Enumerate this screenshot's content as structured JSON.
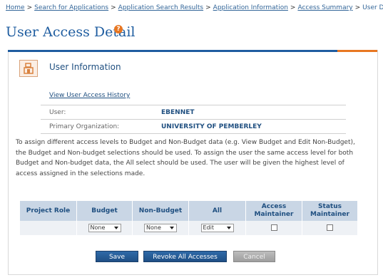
{
  "breadcrumb": {
    "items": [
      "Home",
      "Search for Applications",
      "Application Search Results",
      "Application Information",
      "Access Summary"
    ],
    "separator": ">",
    "current": "User Detail"
  },
  "page": {
    "title": "User Access Detail",
    "help_icon": "?"
  },
  "section": {
    "title": "User Information",
    "icon": "user-info-icon"
  },
  "history_link": "View User Access History",
  "user_info": {
    "user_label": "User:",
    "user_value": "EBENNET",
    "org_label": "Primary Organization:",
    "org_value": "UNIVERSITY OF PEMBERLEY"
  },
  "instructions": "To assign different access levels to Budget and Non-Budget data (e.g. View Budget and Edit Non-Budget), the Budget and Non-budget selections should be used. To assign the user the same access level for both Budget and Non-budget data, the All select should be used. The user will be given the highest level of access assigned in the selections made.",
  "grid": {
    "headers": {
      "project_role": "Project Role",
      "budget": "Budget",
      "non_budget": "Non-Budget",
      "all": "All",
      "access_maintainer_1": "Access",
      "access_maintainer_2": "Maintainer",
      "status_maintainer_1": "Status",
      "status_maintainer_2": "Maintainer"
    },
    "row": {
      "project_role": "",
      "budget": "None",
      "non_budget": "None",
      "all": "Edit",
      "access_maintainer": false,
      "status_maintainer": false
    }
  },
  "buttons": {
    "save": "Save",
    "revoke": "Revoke All Accesses",
    "cancel": "Cancel"
  },
  "colors": {
    "accent": "#1f5da0",
    "highlight": "#e87722",
    "header_bg": "#c9d6e5"
  }
}
